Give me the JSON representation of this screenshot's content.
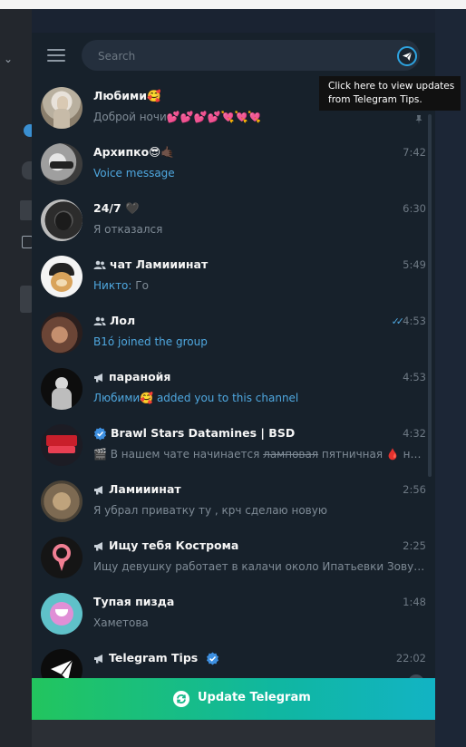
{
  "search": {
    "placeholder": "Search"
  },
  "tooltip": {
    "line1": "Click here to view updates",
    "line2": "from Telegram Tips."
  },
  "chats": [
    {
      "name": "Любими🥰",
      "time": "",
      "message": "Доброй ночи💕💕💕💕💘💘💘",
      "pinned": true
    },
    {
      "name": "Архипко😎🤙🏿",
      "time": "7:42",
      "message": "Voice message",
      "message_blue": true
    },
    {
      "name": "24/7 🖤",
      "time": "6:30",
      "message": "Я отказался"
    },
    {
      "name": "чат Ламииинат",
      "time": "5:49",
      "sender": "Никто:",
      "message": " Го",
      "type": "group"
    },
    {
      "name": "Лол",
      "time": "4:53",
      "message": "B1ó joined the group",
      "message_blue": true,
      "type": "group",
      "read_checks": "✓✓"
    },
    {
      "name": "паранойя",
      "time": "4:53",
      "sender": "Любими🥰",
      "message": " added you to this channel",
      "message_blue": true,
      "type": "channel"
    },
    {
      "name": "Brawl Stars Datamines | BSD",
      "time": "4:32",
      "message_prefix": "🎬 В нашем чате начинается ",
      "message_strike": "ламповая",
      "message": " пятничная 🩸 но...",
      "type": "verified"
    },
    {
      "name": "Ламииинат",
      "time": "2:56",
      "message": "Я убрал приватку ту , крч сделаю новую",
      "type": "channel"
    },
    {
      "name": "Ищу тебя Кострома",
      "time": "2:25",
      "message": "Ищу девушку работает в калачи около Ипатьевки  Зовут...",
      "type": "channel"
    },
    {
      "name": "Тупая пизда",
      "time": "1:48",
      "message": "Хаметова"
    },
    {
      "name": "Telegram Tips",
      "time": "22:02",
      "message": "",
      "type": "channel-verified"
    }
  ],
  "update": {
    "label": "Update Telegram"
  },
  "colors": {
    "panel": "#17212b",
    "search": "#242f3d",
    "accent": "#4fa8e0",
    "muted": "#6d7883",
    "update_start": "#22c55e",
    "update_end": "#12b3c4"
  }
}
